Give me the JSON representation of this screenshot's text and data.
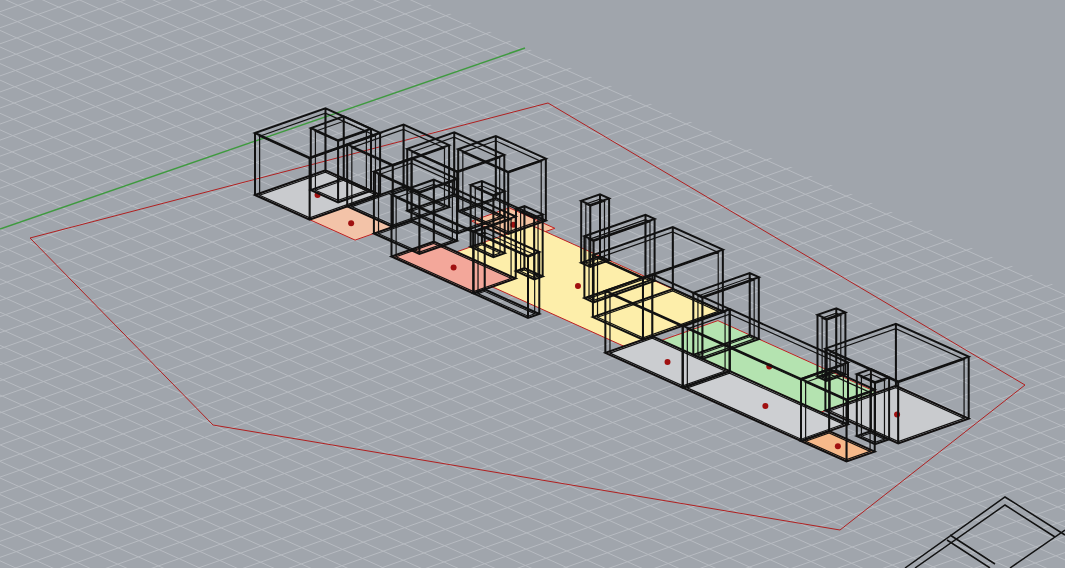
{
  "viewport": {
    "rooms": [
      {
        "color": "#c9cbce"
      },
      {
        "color": "#f3c3a8"
      },
      {
        "color": "#f5c4a2"
      },
      {
        "color": "#fdeeaa"
      },
      {
        "color": "#f3a79a"
      },
      {
        "color": "#b4e3b0"
      },
      {
        "color": "#cbcdd0"
      },
      {
        "color": "#cdcfd2"
      },
      {
        "color": "#c9cbce"
      },
      {
        "color": "#f6b98a"
      }
    ]
  }
}
